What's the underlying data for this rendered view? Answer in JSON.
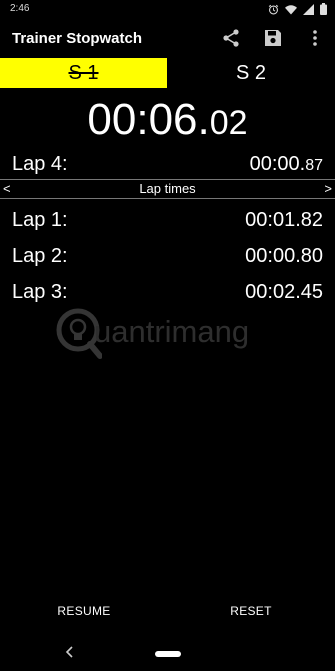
{
  "status_bar": {
    "time": "2:46",
    "icons": [
      "alarm-icon",
      "wifi-icon",
      "signal-icon",
      "battery-icon"
    ]
  },
  "app_bar": {
    "title": "Trainer Stopwatch",
    "actions": [
      "share-icon",
      "save-icon",
      "more-vert-icon"
    ]
  },
  "tabs": [
    {
      "label": "S 1",
      "selected": true,
      "color": "#ffff00"
    },
    {
      "label": "S 2",
      "selected": false
    }
  ],
  "timer": {
    "main": "00:06.",
    "hundredths": "02"
  },
  "current_lap": {
    "label": "Lap 4:",
    "time": "00:00.",
    "hundredths": "87"
  },
  "lap_section": {
    "title": "Lap times",
    "prev": "<",
    "next": ">"
  },
  "laps": [
    {
      "label": "Lap 1:",
      "time": "00:01.82"
    },
    {
      "label": "Lap 2:",
      "time": "00:00.80"
    },
    {
      "label": "Lap 3:",
      "time": "00:02.45"
    }
  ],
  "watermark": {
    "text": "uantrimang",
    "icon": "bulb-icon"
  },
  "buttons": {
    "resume": "RESUME",
    "reset": "RESET"
  },
  "nav": {
    "back": "chevron-left-icon",
    "home": "home-pill"
  }
}
